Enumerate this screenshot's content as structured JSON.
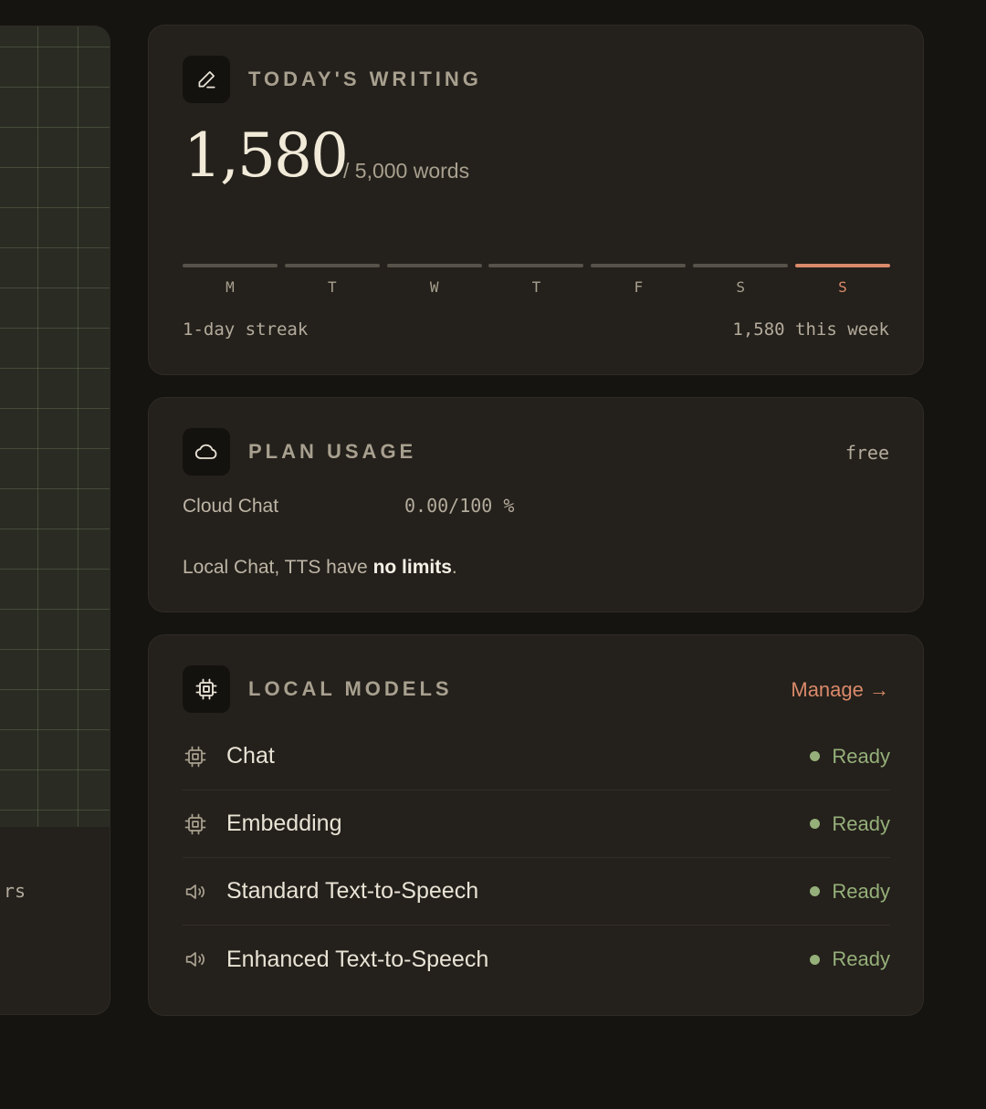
{
  "left_panel": {
    "truncated_text": "rs"
  },
  "writing": {
    "title": "TODAY'S WRITING",
    "icon": "pencil-icon",
    "count": "1,580",
    "goal": "/ 5,000 words",
    "days": [
      "M",
      "T",
      "W",
      "T",
      "F",
      "S",
      "S"
    ],
    "active_day_index": 6,
    "streak": "1-day streak",
    "week_total": "1,580 this week"
  },
  "plan": {
    "title": "PLAN USAGE",
    "icon": "cloud-icon",
    "tier": "free",
    "usage_label": "Cloud Chat",
    "usage_value": "0.00/100 %",
    "note_prefix": "Local Chat, TTS have ",
    "note_bold": "no limits",
    "note_suffix": "."
  },
  "models": {
    "title": "LOCAL MODELS",
    "icon": "chip-icon",
    "manage_label": "Manage →",
    "items": [
      {
        "name": "Chat",
        "icon": "chip-icon",
        "status": "Ready"
      },
      {
        "name": "Embedding",
        "icon": "chip-icon",
        "status": "Ready"
      },
      {
        "name": "Standard Text-to-Speech",
        "icon": "speaker-icon",
        "status": "Ready"
      },
      {
        "name": "Enhanced Text-to-Speech",
        "icon": "speaker-icon",
        "status": "Ready"
      }
    ]
  },
  "colors": {
    "accent": "#d98a6a",
    "ready": "#95b07a",
    "card": "#24201b",
    "background": "#151411"
  }
}
